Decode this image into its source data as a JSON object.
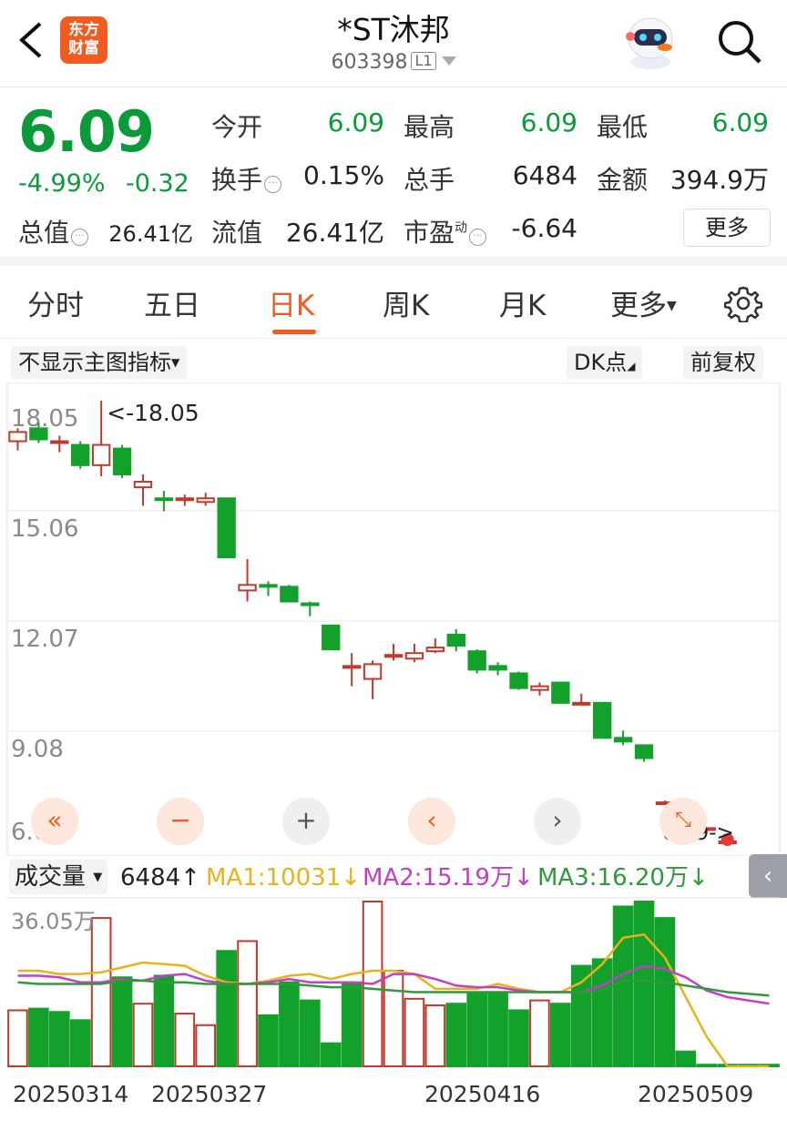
{
  "header": {
    "logo_line1": "东方",
    "logo_line2": "财富",
    "title": "*ST沐邦",
    "code": "603398",
    "level": "L1"
  },
  "quote": {
    "price": "6.09",
    "pct": "-4.99%",
    "change": "-0.32",
    "open_label": "今开",
    "open": "6.09",
    "high_label": "最高",
    "high": "6.09",
    "low_label": "最低",
    "low": "6.09",
    "turnover_label": "换手",
    "turnover": "0.15%",
    "volume_label": "总手",
    "volume": "6484",
    "amount_label": "金额",
    "amount": "394.9万",
    "mktcap_label": "总值",
    "mktcap": "26.41亿",
    "float_label": "流值",
    "float": "26.41亿",
    "pe_label": "市盈",
    "pe_sup": "动",
    "pe": "-6.64",
    "more": "更多"
  },
  "tabs": {
    "items": [
      "分时",
      "五日",
      "日K",
      "周K",
      "月K",
      "更多"
    ],
    "active": 2
  },
  "chart": {
    "indicator_select": "不显示主图指标",
    "dk": "DK点",
    "adjust": "前复权",
    "y_labels": [
      "18.05",
      "15.06",
      "12.07",
      "9.08",
      "6.09"
    ],
    "max_note": "<-18.05",
    "last_note": "6.09->",
    "colors": {
      "up": "#c0392b",
      "down": "#12a12a"
    }
  },
  "volume": {
    "select": "成交量",
    "current": "6484↑",
    "ma1": "MA1:10031↓",
    "ma2": "MA2:15.19万↓",
    "ma3": "MA3:16.20万↓",
    "max_label": "36.05万",
    "dates": [
      "20250314",
      "20250327",
      "20250416",
      "20250509"
    ],
    "colors": {
      "ma1": "#e8b21a",
      "ma2": "#c13fc9",
      "ma3": "#2f9a3a"
    }
  },
  "chart_data": {
    "type": "candlestick",
    "y_range": [
      6.09,
      18.05
    ],
    "candles": [
      {
        "o": 16.95,
        "h": 17.3,
        "l": 16.7,
        "c": 17.2
      },
      {
        "o": 17.3,
        "h": 17.45,
        "l": 16.9,
        "c": 17.0
      },
      {
        "o": 16.95,
        "h": 17.1,
        "l": 16.65,
        "c": 16.95
      },
      {
        "o": 16.85,
        "h": 16.95,
        "l": 16.2,
        "c": 16.3
      },
      {
        "o": 16.3,
        "h": 18.05,
        "l": 16.0,
        "c": 16.85
      },
      {
        "o": 16.75,
        "h": 16.85,
        "l": 15.95,
        "c": 16.05
      },
      {
        "o": 15.7,
        "h": 16.05,
        "l": 15.2,
        "c": 15.85
      },
      {
        "o": 15.4,
        "h": 15.6,
        "l": 15.05,
        "c": 15.35
      },
      {
        "o": 15.35,
        "h": 15.5,
        "l": 15.2,
        "c": 15.4
      },
      {
        "o": 15.3,
        "h": 15.55,
        "l": 15.2,
        "c": 15.4
      },
      {
        "o": 15.4,
        "h": 15.4,
        "l": 13.8,
        "c": 13.8
      },
      {
        "o": 12.9,
        "h": 13.75,
        "l": 12.6,
        "c": 13.05
      },
      {
        "o": 13.05,
        "h": 13.15,
        "l": 12.75,
        "c": 13.0
      },
      {
        "o": 13.0,
        "h": 13.05,
        "l": 12.6,
        "c": 12.6
      },
      {
        "o": 12.55,
        "h": 12.6,
        "l": 12.2,
        "c": 12.5
      },
      {
        "o": 11.95,
        "h": 11.95,
        "l": 11.3,
        "c": 11.3
      },
      {
        "o": 10.85,
        "h": 11.2,
        "l": 10.3,
        "c": 10.85
      },
      {
        "o": 10.5,
        "h": 11.0,
        "l": 9.95,
        "c": 10.9
      },
      {
        "o": 11.1,
        "h": 11.45,
        "l": 11.0,
        "c": 11.15
      },
      {
        "o": 11.05,
        "h": 11.45,
        "l": 10.95,
        "c": 11.2
      },
      {
        "o": 11.25,
        "h": 11.6,
        "l": 11.2,
        "c": 11.35
      },
      {
        "o": 11.7,
        "h": 11.85,
        "l": 11.25,
        "c": 11.4
      },
      {
        "o": 11.25,
        "h": 11.3,
        "l": 10.65,
        "c": 10.75
      },
      {
        "o": 10.85,
        "h": 10.95,
        "l": 10.6,
        "c": 10.75
      },
      {
        "o": 10.65,
        "h": 10.7,
        "l": 10.2,
        "c": 10.25
      },
      {
        "o": 10.2,
        "h": 10.4,
        "l": 10.05,
        "c": 10.3
      },
      {
        "o": 10.4,
        "h": 10.4,
        "l": 9.85,
        "c": 9.85
      },
      {
        "o": 9.85,
        "h": 10.1,
        "l": 9.8,
        "c": 9.85
      },
      {
        "o": 9.85,
        "h": 9.85,
        "l": 8.9,
        "c": 8.9
      },
      {
        "o": 8.9,
        "h": 9.1,
        "l": 8.7,
        "c": 8.8
      },
      {
        "o": 8.7,
        "h": 8.7,
        "l": 8.25,
        "c": 8.35
      },
      {
        "o": 7.15,
        "h": 7.2,
        "l": 7.1,
        "c": 7.15
      },
      {
        "o": 6.79,
        "h": 6.8,
        "l": 6.75,
        "c": 6.79
      },
      {
        "o": 6.45,
        "h": 6.46,
        "l": 6.44,
        "c": 6.45
      },
      {
        "o": 6.09,
        "h": 6.09,
        "l": 6.09,
        "c": 6.09
      }
    ],
    "volume": {
      "max": 360500,
      "values": [
        60000,
        64000,
        62000,
        55000,
        360500,
        154000,
        100000,
        120000,
        91000,
        62000,
        196000,
        219000,
        91000,
        132000,
        112000,
        46000,
        132000,
        300000,
        146000,
        99000,
        94000,
        92000,
        155000,
        160000,
        121000,
        148000,
        145000,
        232000,
        256000,
        324000,
        335000,
        305000,
        0,
        0,
        0,
        0,
        0
      ],
      "volume_display_fraction": [
        0.34,
        0.35,
        0.33,
        0.28,
        0.9,
        0.54,
        0.38,
        0.55,
        0.32,
        0.25,
        0.7,
        0.76,
        0.31,
        0.51,
        0.4,
        0.14,
        0.51,
        1.0,
        0.58,
        0.41,
        0.37,
        0.38,
        0.45,
        0.45,
        0.34,
        0.4,
        0.38,
        0.61,
        0.65,
        0.97,
        1.0,
        0.9,
        0.09,
        0.01,
        0.01,
        0.01,
        0.01
      ]
    },
    "ma1": [
      0.58,
      0.58,
      0.56,
      0.56,
      0.57,
      0.6,
      0.63,
      0.62,
      0.61,
      0.55,
      0.51,
      0.5,
      0.52,
      0.55,
      0.56,
      0.53,
      0.56,
      0.58,
      0.58,
      0.56,
      0.47,
      0.47,
      0.47,
      0.5,
      0.47,
      0.45,
      0.45,
      0.51,
      0.62,
      0.78,
      0.8,
      0.66,
      0.42,
      0.18,
      0.0,
      0.0,
      0.0
    ],
    "ma2": [
      0.55,
      0.55,
      0.54,
      0.51,
      0.51,
      0.53,
      0.52,
      0.55,
      0.56,
      0.52,
      0.5,
      0.5,
      0.51,
      0.53,
      0.51,
      0.51,
      0.51,
      0.5,
      0.56,
      0.56,
      0.53,
      0.49,
      0.48,
      0.48,
      0.46,
      0.45,
      0.45,
      0.45,
      0.49,
      0.56,
      0.61,
      0.59,
      0.54,
      0.46,
      0.42,
      0.4,
      0.38
    ],
    "ma3": [
      0.51,
      0.5,
      0.5,
      0.5,
      0.5,
      0.52,
      0.52,
      0.51,
      0.51,
      0.5,
      0.5,
      0.5,
      0.5,
      0.5,
      0.49,
      0.48,
      0.48,
      0.47,
      0.46,
      0.45,
      0.45,
      0.45,
      0.45,
      0.45,
      0.45,
      0.45,
      0.45,
      0.45,
      0.46,
      0.52,
      0.52,
      0.51,
      0.49,
      0.47,
      0.45,
      0.44,
      0.43
    ]
  }
}
